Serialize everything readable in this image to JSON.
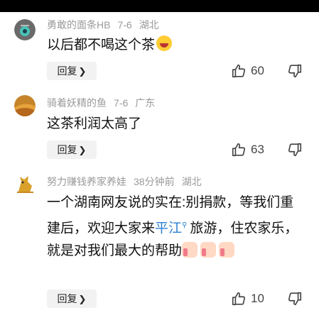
{
  "comments": [
    {
      "username": "勇敢的面条HB",
      "date": "7-6",
      "location": "湖北",
      "text": "以后都不喝这个茶",
      "emoji": "laughing-crying-emoji",
      "reply_label": "回复",
      "likes": "60"
    },
    {
      "username": "骑着妖精的鱼",
      "date": "7-6",
      "location": "广东",
      "text": "这茶利润太高了",
      "reply_label": "回复",
      "likes": "63"
    },
    {
      "username": "努力赚钱养家养娃",
      "date": "38分钟前",
      "location": "湖北",
      "text_part1": "一个湖南网友说的实在:别捐款，等我们重建后，欢迎大家来",
      "link_text": "平江",
      "text_part2": "旅游，住农家乐，就是对我们最大的帮助",
      "emoji": "thumbs-up-emoji",
      "reply_label": "回复",
      "likes": "10"
    }
  ],
  "colors": {
    "meta_gray": "#9a9a9a",
    "link_blue": "#2a7fd4",
    "reply_bg": "#f2f2f2"
  }
}
